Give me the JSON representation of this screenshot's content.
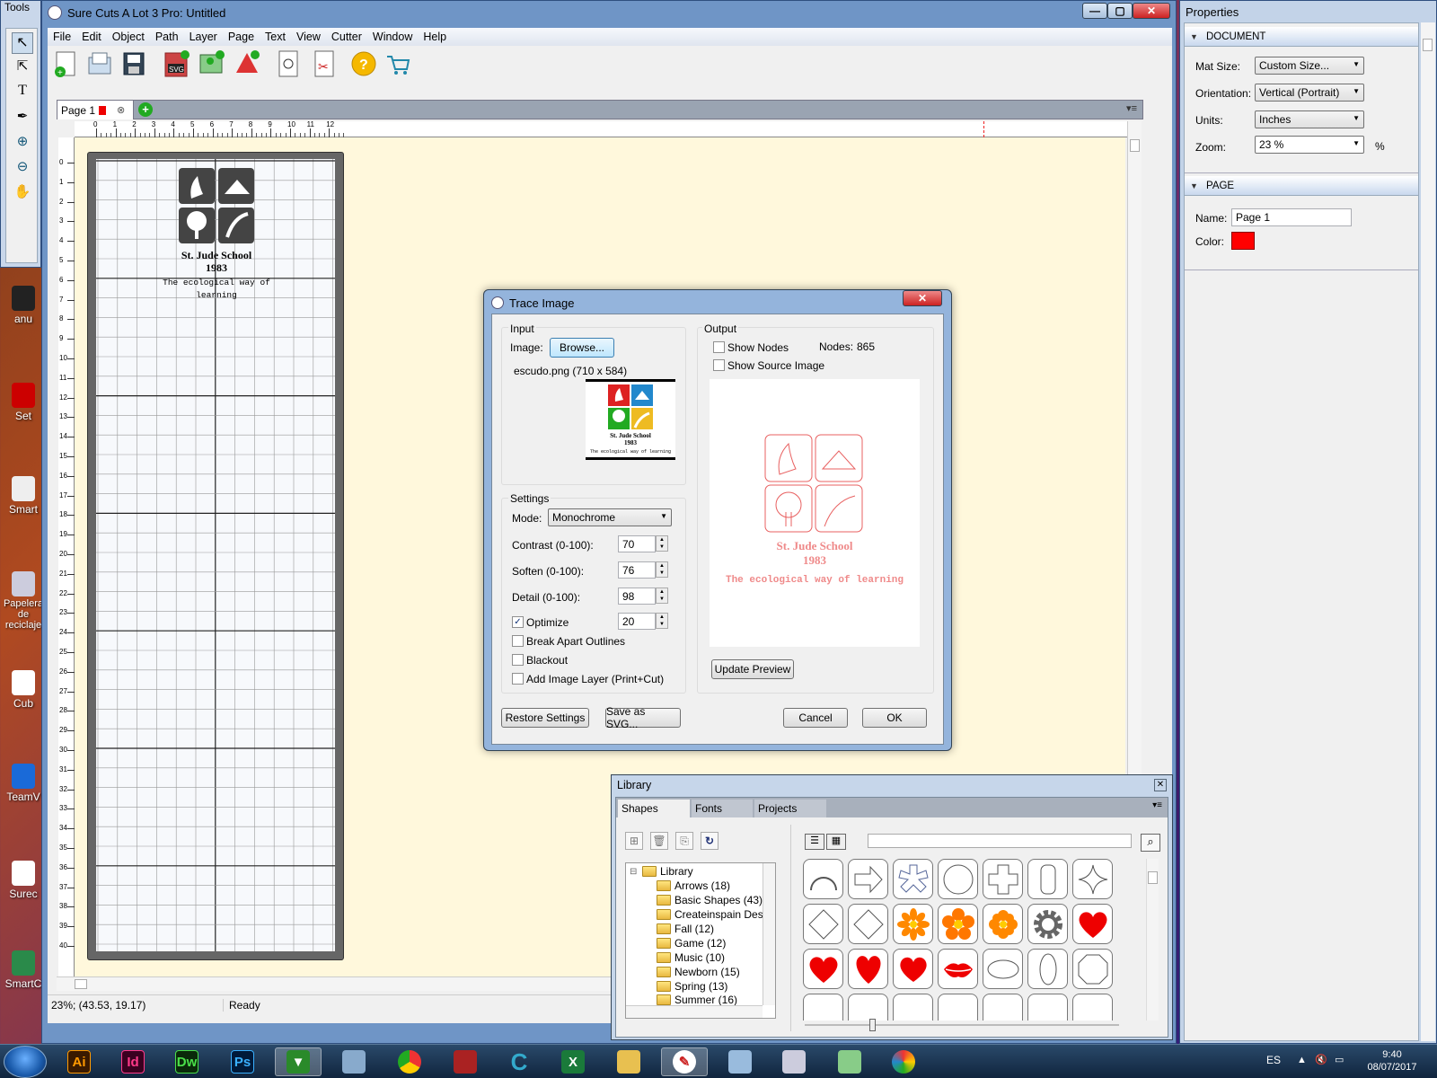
{
  "desktop": {
    "icons": [
      {
        "label": "anu"
      },
      {
        "label": "Set"
      },
      {
        "label": "Smart"
      },
      {
        "label": "Papelera de reciclaje"
      },
      {
        "label": "Cub"
      },
      {
        "label": "TeamV"
      },
      {
        "label": "Surec"
      },
      {
        "label": "SmartC"
      }
    ]
  },
  "tools_panel": {
    "title": "Tools"
  },
  "app": {
    "title": "Sure Cuts A Lot 3 Pro: Untitled",
    "menu": [
      "File",
      "Edit",
      "Object",
      "Path",
      "Layer",
      "Page",
      "Text",
      "View",
      "Cutter",
      "Window",
      "Help"
    ],
    "toolbar_icons": [
      "new-document",
      "open",
      "save",
      "import-svg",
      "import-image",
      "import-pdf",
      "preview",
      "cut",
      "help",
      "shop"
    ],
    "page_tab": {
      "label": "Page 1"
    },
    "ruler_h": [
      "0",
      "1",
      "2",
      "3",
      "4",
      "5",
      "6",
      "7",
      "8",
      "9",
      "10",
      "11",
      "12"
    ],
    "ruler_v": [
      "0",
      "1",
      "2",
      "3",
      "4",
      "5",
      "6",
      "7",
      "8",
      "9",
      "10",
      "11",
      "12",
      "13",
      "14",
      "15",
      "16",
      "17",
      "18",
      "19",
      "20",
      "21",
      "22",
      "23",
      "24",
      "25",
      "26",
      "27",
      "28",
      "29",
      "30",
      "31",
      "32",
      "33",
      "34",
      "35",
      "36",
      "37",
      "38",
      "39",
      "40"
    ],
    "canvas_logo": {
      "line1": "St. Jude School",
      "line2": "1983",
      "line3": "The ecological way of learning"
    },
    "status": {
      "coords": "23%; (43.53, 19.17)",
      "state": "Ready"
    }
  },
  "properties": {
    "title": "Properties",
    "document": {
      "header": "DOCUMENT",
      "mat_size_label": "Mat Size:",
      "mat_size": "Custom Size...",
      "orientation_label": "Orientation:",
      "orientation": "Vertical (Portrait)",
      "units_label": "Units:",
      "units": "Inches",
      "zoom_label": "Zoom:",
      "zoom": "23 %",
      "zoom_unit": "%"
    },
    "page": {
      "header": "PAGE",
      "name_label": "Name:",
      "name": "Page 1",
      "color_label": "Color:",
      "color": "#ff0000"
    }
  },
  "trace": {
    "title": "Trace Image",
    "input_label": "Input",
    "image_label": "Image:",
    "browse": "Browse...",
    "filename": "escudo.png (710 x 584)",
    "output_label": "Output",
    "show_nodes": "Show Nodes",
    "nodes_label": "Nodes:",
    "nodes": "865",
    "show_source": "Show Source Image",
    "settings_label": "Settings",
    "mode_label": "Mode:",
    "mode": "Monochrome",
    "contrast_label": "Contrast (0-100):",
    "contrast": "70",
    "soften_label": "Soften (0-100):",
    "soften": "76",
    "detail_label": "Detail (0-100):",
    "detail": "98",
    "optimize_label": "Optimize",
    "optimize": "20",
    "break_apart": "Break Apart Outlines",
    "blackout": "Blackout",
    "add_image_layer": "Add Image Layer (Print+Cut)",
    "update_preview": "Update Preview",
    "restore": "Restore Settings",
    "save_svg": "Save as SVG...",
    "cancel": "Cancel",
    "ok": "OK",
    "preview": {
      "line1": "St. Jude School",
      "line2": "1983",
      "line3": "The ecological way of learning"
    },
    "thumb": {
      "line1": "St. Jude School",
      "line2": "1983",
      "line3": "The ecological way of learning"
    }
  },
  "library": {
    "title": "Library",
    "tabs": [
      "Shapes",
      "Fonts",
      "Projects"
    ],
    "root": "Library",
    "folders": [
      "Arrows (18)",
      "Basic Shapes (43)",
      "Createinspain Desi",
      "Fall (12)",
      "Game (12)",
      "Music (10)",
      "Newborn (15)",
      "Spring (13)",
      "Summer (16)"
    ],
    "search_placeholder": ""
  },
  "tray": {
    "lang": "ES",
    "time": "9:40",
    "date": "08/07/2017"
  },
  "taskbar": [
    "Ai",
    "Id",
    "Dw",
    "Ps"
  ]
}
